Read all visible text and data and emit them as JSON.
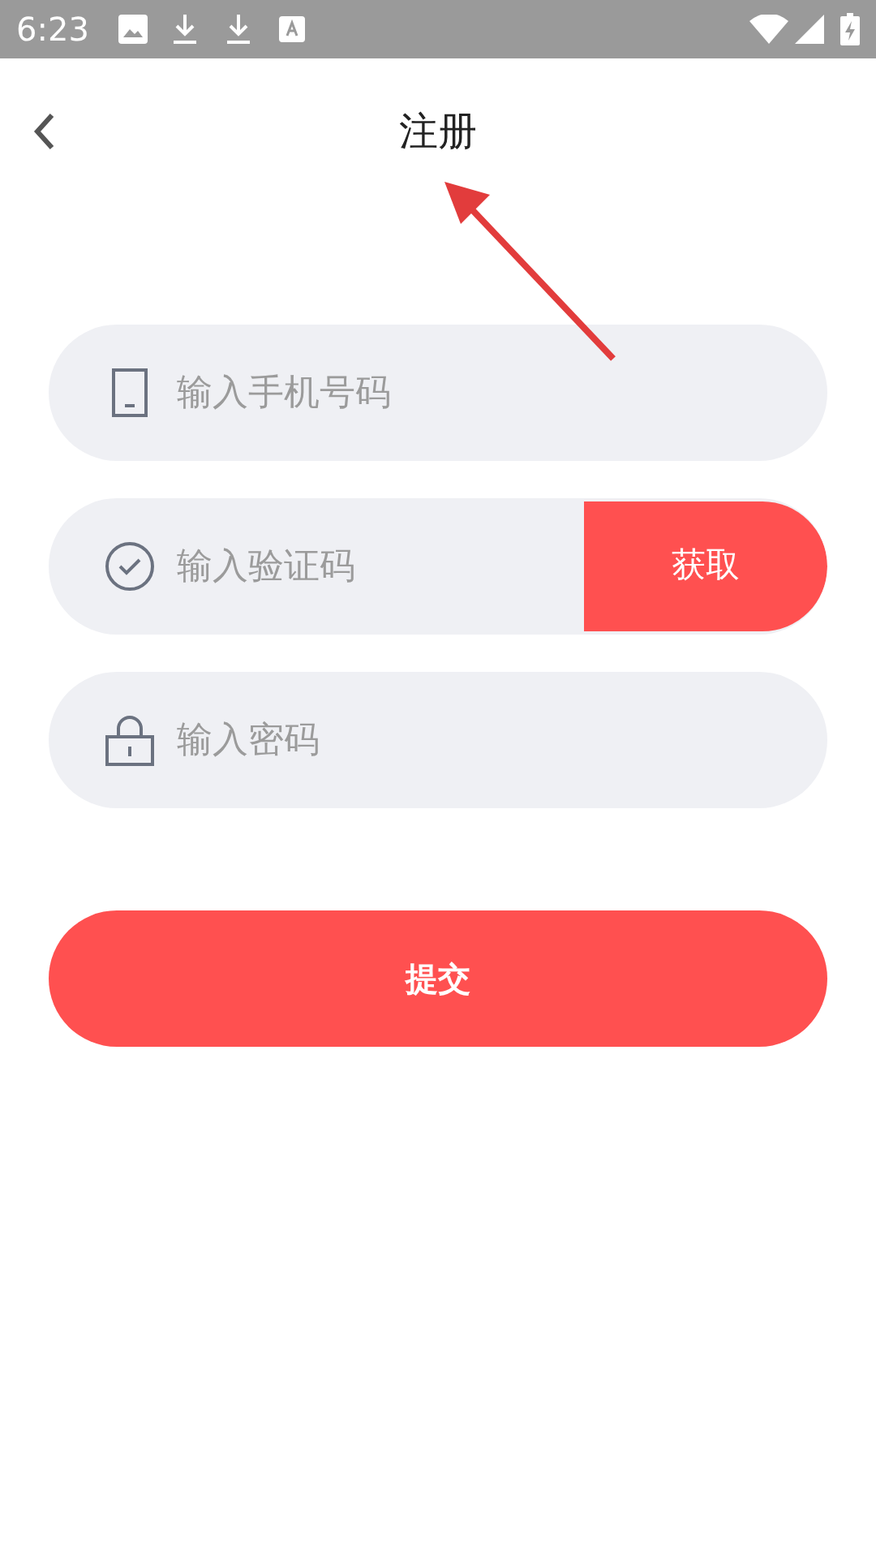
{
  "status_bar": {
    "time": "6:23"
  },
  "header": {
    "title": "注册"
  },
  "fields": [
    {
      "kind": "phone",
      "placeholder": "输入手机号码"
    },
    {
      "kind": "code",
      "placeholder": "输入验证码",
      "button": "获取"
    },
    {
      "kind": "password",
      "placeholder": "输入密码"
    }
  ],
  "submit": {
    "label": "提交"
  }
}
